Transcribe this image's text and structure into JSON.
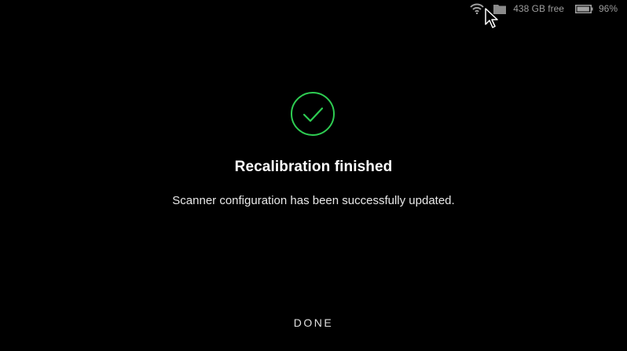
{
  "status_bar": {
    "wifi_icon": "wifi-icon",
    "storage_icon": "folder-icon",
    "storage_text": "438 GB free",
    "battery_icon": "battery-icon",
    "battery_text": "96%",
    "battery_level": 0.96,
    "text_color": "#9e9e9e"
  },
  "dialog": {
    "status_icon": "check-circle-icon",
    "accent_color": "#2ecc52",
    "title": "Recalibration finished",
    "message": "Scanner configuration has been successfully updated.",
    "done_label": "DONE"
  }
}
